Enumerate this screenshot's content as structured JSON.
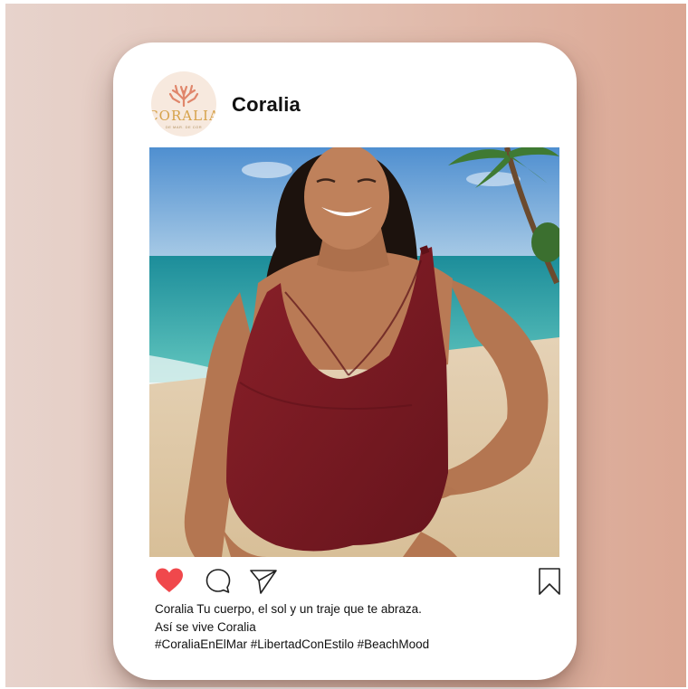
{
  "post": {
    "username": "Coralia",
    "avatar_text": "CORALIA",
    "avatar_tagline": "DE MAR. DE COR",
    "photo": "woman-in-burgundy-swimsuit-on-beach",
    "caption_line1": "Coralia Tu cuerpo, el sol y un traje que te abraza.",
    "caption_line2": "Así se vive Coralia",
    "hashtags": "#CoraliaEnElMar #LibertadConEstilo #BeachMood",
    "liked": true
  },
  "icons": {
    "like": "heart-icon",
    "comment": "comment-icon",
    "share": "send-icon",
    "save": "bookmark-icon",
    "logo": "coral-branch-icon"
  },
  "colors": {
    "background_left": "#e7d3cc",
    "background_right": "#dba793",
    "card": "#ffffff",
    "heart": "#f0484c",
    "logo_coral": "#e0866b",
    "logo_text": "#d6a24a",
    "swimsuit": "#7b1a22"
  }
}
